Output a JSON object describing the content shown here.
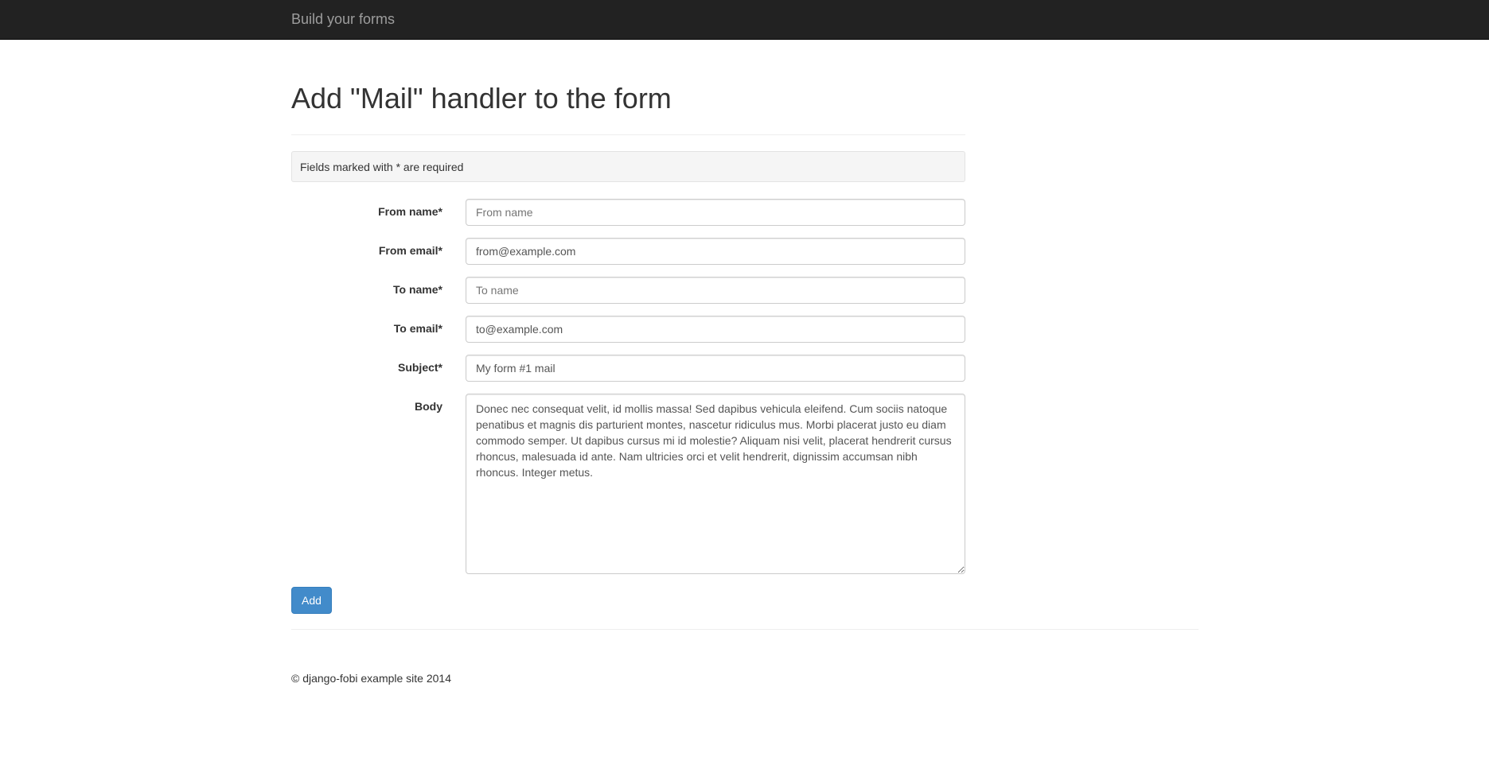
{
  "navbar": {
    "brand": "Build your forms"
  },
  "page": {
    "title": "Add \"Mail\" handler to the form",
    "required_note": "Fields marked with * are required"
  },
  "form": {
    "from_name": {
      "label": "From name*",
      "value": "",
      "placeholder": "From name"
    },
    "from_email": {
      "label": "From email*",
      "value": "from@example.com"
    },
    "to_name": {
      "label": "To name*",
      "value": "",
      "placeholder": "To name"
    },
    "to_email": {
      "label": "To email*",
      "value": "to@example.com"
    },
    "subject": {
      "label": "Subject*",
      "value": "My form #1 mail"
    },
    "body": {
      "label": "Body",
      "value": "Donec nec consequat velit, id mollis massa! Sed dapibus vehicula eleifend. Cum sociis natoque penatibus et magnis dis parturient montes, nascetur ridiculus mus. Morbi placerat justo eu diam commodo semper. Ut dapibus cursus mi id molestie? Aliquam nisi velit, placerat hendrerit cursus rhoncus, malesuada id ante. Nam ultricies orci et velit hendrerit, dignissim accumsan nibh rhoncus. Integer metus."
    },
    "submit_label": "Add"
  },
  "footer": {
    "text": "© django-fobi example site 2014"
  },
  "colors": {
    "navbar_bg": "#222222",
    "brand_text": "#9d9d9d",
    "primary_button": "#428bca"
  }
}
